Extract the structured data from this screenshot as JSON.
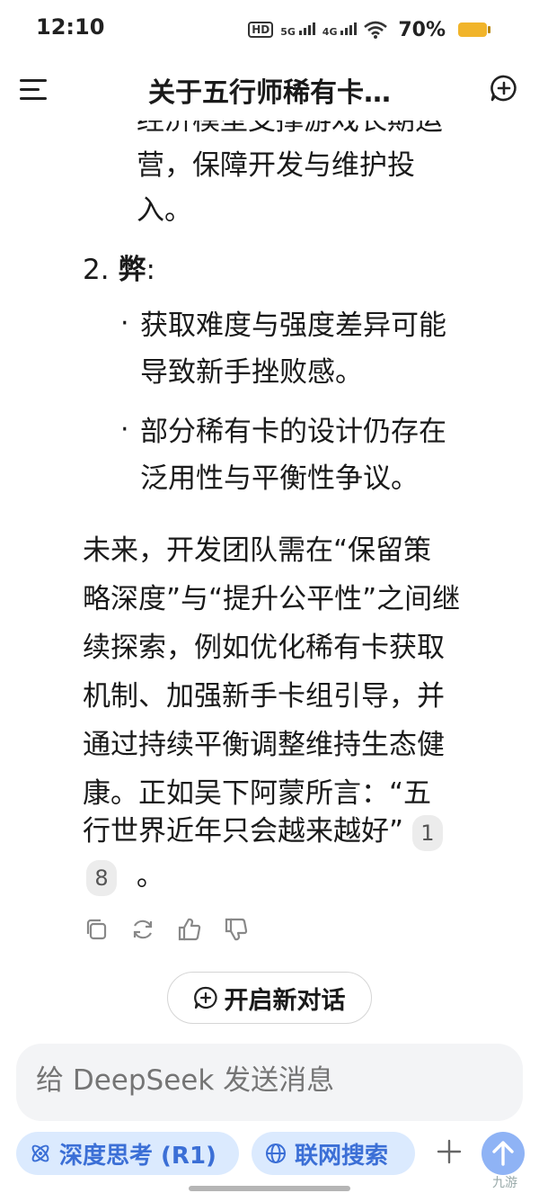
{
  "status_bar": {
    "time": "12:10",
    "net_label": "HD",
    "sim1": "5G",
    "sim2": "4G",
    "battery": "70%"
  },
  "header": {
    "title": "关于五行师稀有卡…"
  },
  "message": {
    "cut_top_line": "经济模型支撑游戏长期运",
    "line_a": "营，保障开发与维护投",
    "line_b": "入。",
    "item2_number": "2.",
    "item2_label": "弊",
    "item2_colon": ":",
    "bullets": [
      {
        "line1": "获取难度与强度差异可能",
        "line2": "导致新手挫败感。"
      },
      {
        "line1": "部分稀有卡的设计仍存在",
        "line2": "泛用性与平衡性争议。"
      }
    ],
    "paragraph_lines": [
      "未来，开发团队需在“保留策",
      "略深度”与“提升公平性”之间继",
      "续探索，例如优化稀有卡获取",
      "机制、加强新手卡组引导，并",
      "通过持续平衡调整维持生态健",
      "康。正如吴下阿蒙所言：“五",
      "行世界近年只会越来越好”"
    ],
    "cite1": "1",
    "cite2": "8",
    "period": "。"
  },
  "new_chat": {
    "label": "开启新对话"
  },
  "input": {
    "placeholder": "给 DeepSeek 发送消息"
  },
  "chips": {
    "deep_think": "深度思考 (R1)",
    "web_search": "联网搜索"
  },
  "watermark": "九游",
  "colors": {
    "accent": "#3b6fd6",
    "chip_bg": "#dbeafe",
    "send_bg": "#8fb3f5",
    "battery": "#f1b42a"
  }
}
